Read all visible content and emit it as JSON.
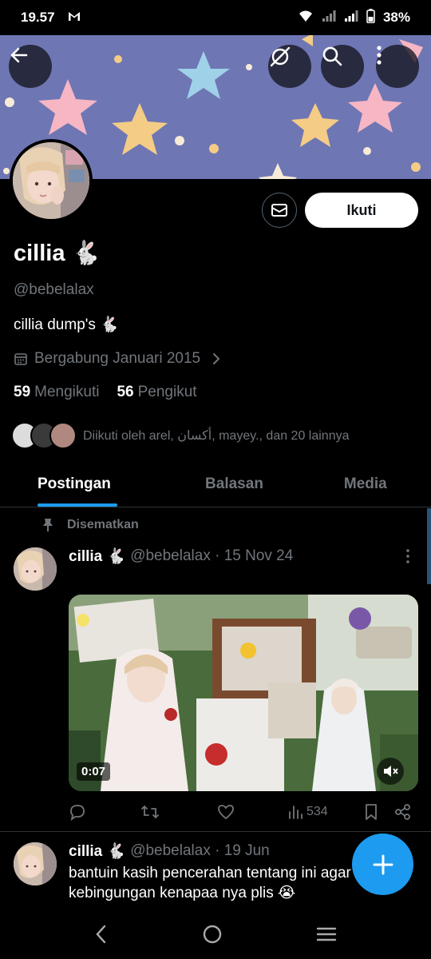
{
  "status": {
    "time": "19.57",
    "mail_icon": "gmail-icon",
    "battery": "38%"
  },
  "profile": {
    "name": "cillia 🐇",
    "handle": "@bebelalax",
    "bio": "cillia dump's 🐇",
    "joined": "Bergabung Januari 2015",
    "following_count": "59",
    "following_label": "Mengikuti",
    "followers_count": "56",
    "followers_label": "Pengikut",
    "followed_by": "Diikuti oleh arel, أكسان, mayey., dan 20 lainnya",
    "follow_label": "Ikuti"
  },
  "tabs": [
    {
      "label": "Postingan"
    },
    {
      "label": "Balasan"
    },
    {
      "label": "Media"
    }
  ],
  "pinned_label": "Disematkan",
  "posts": [
    {
      "name": "cillia 🐇",
      "meta": "@bebelalax · 15 Nov 24",
      "duration": "0:07",
      "views": "534"
    },
    {
      "name": "cillia 🐇",
      "meta": "@bebelalax · 19 Jun",
      "text": "bantuin kasih pencerahan tentang ini agar tidak kebingungan kenapaa nya plis 😭"
    }
  ],
  "colors": {
    "accent": "#1d9bf0",
    "banner": "#7078b6",
    "muted": "#71767b"
  }
}
